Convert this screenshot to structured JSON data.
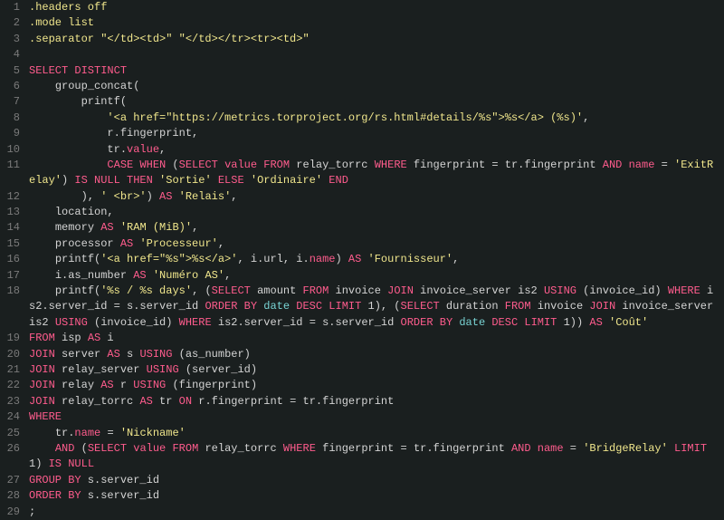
{
  "lines": [
    {
      "n": "1",
      "frags": [
        {
          "c": "str",
          "t": ".headers off"
        }
      ]
    },
    {
      "n": "2",
      "frags": [
        {
          "c": "str",
          "t": ".mode list"
        }
      ]
    },
    {
      "n": "3",
      "frags": [
        {
          "c": "str",
          "t": ".separator \"</td><td>\" \"</td></tr><tr><td>\""
        }
      ]
    },
    {
      "n": "4",
      "frags": []
    },
    {
      "n": "5",
      "frags": [
        {
          "c": "kw",
          "t": "SELECT DISTINCT"
        }
      ]
    },
    {
      "n": "6",
      "frags": [
        {
          "c": "ident",
          "t": "    group_concat("
        }
      ]
    },
    {
      "n": "7",
      "frags": [
        {
          "c": "ident",
          "t": "        printf("
        }
      ]
    },
    {
      "n": "8",
      "frags": [
        {
          "c": "ident",
          "t": "            "
        },
        {
          "c": "str",
          "t": "'<a href=\"https://metrics.torproject.org/rs.html#details/%s\">%s</a> (%s)'"
        },
        {
          "c": "ident",
          "t": ","
        }
      ]
    },
    {
      "n": "9",
      "frags": [
        {
          "c": "ident",
          "t": "            r.fingerprint,"
        }
      ]
    },
    {
      "n": "10",
      "frags": [
        {
          "c": "ident",
          "t": "            tr."
        },
        {
          "c": "kw",
          "t": "value"
        },
        {
          "c": "ident",
          "t": ","
        }
      ]
    },
    {
      "n": "11",
      "frags": [
        {
          "c": "ident",
          "t": "            "
        },
        {
          "c": "kw",
          "t": "CASE WHEN"
        },
        {
          "c": "ident",
          "t": " ("
        },
        {
          "c": "kw",
          "t": "SELECT"
        },
        {
          "c": "ident",
          "t": " "
        },
        {
          "c": "kw",
          "t": "value"
        },
        {
          "c": "ident",
          "t": " "
        },
        {
          "c": "kw",
          "t": "FROM"
        },
        {
          "c": "ident",
          "t": " relay_torrc "
        },
        {
          "c": "kw",
          "t": "WHERE"
        },
        {
          "c": "ident",
          "t": " fingerprint "
        },
        {
          "c": "op",
          "t": "="
        },
        {
          "c": "ident",
          "t": " tr.fingerprint "
        },
        {
          "c": "kw",
          "t": "AND"
        },
        {
          "c": "ident",
          "t": " "
        },
        {
          "c": "kw",
          "t": "name"
        },
        {
          "c": "ident",
          "t": " "
        },
        {
          "c": "op",
          "t": "="
        },
        {
          "c": "ident",
          "t": " "
        },
        {
          "c": "str",
          "t": "'ExitRelay'"
        },
        {
          "c": "ident",
          "t": ") "
        },
        {
          "c": "kw",
          "t": "IS NULL THEN"
        },
        {
          "c": "ident",
          "t": " "
        },
        {
          "c": "str",
          "t": "'Sortie'"
        },
        {
          "c": "ident",
          "t": " "
        },
        {
          "c": "kw",
          "t": "ELSE"
        },
        {
          "c": "ident",
          "t": " "
        },
        {
          "c": "str",
          "t": "'Ordinaire'"
        },
        {
          "c": "ident",
          "t": " "
        },
        {
          "c": "kw",
          "t": "END"
        }
      ]
    },
    {
      "n": "12",
      "frags": [
        {
          "c": "ident",
          "t": "        ), "
        },
        {
          "c": "str",
          "t": "' <br>'"
        },
        {
          "c": "ident",
          "t": ") "
        },
        {
          "c": "kw",
          "t": "AS"
        },
        {
          "c": "ident",
          "t": " "
        },
        {
          "c": "str",
          "t": "'Relais'"
        },
        {
          "c": "ident",
          "t": ","
        }
      ]
    },
    {
      "n": "13",
      "frags": [
        {
          "c": "ident",
          "t": "    location,"
        }
      ]
    },
    {
      "n": "14",
      "frags": [
        {
          "c": "ident",
          "t": "    memory "
        },
        {
          "c": "kw",
          "t": "AS"
        },
        {
          "c": "ident",
          "t": " "
        },
        {
          "c": "str",
          "t": "'RAM (MiB)'"
        },
        {
          "c": "ident",
          "t": ","
        }
      ]
    },
    {
      "n": "15",
      "frags": [
        {
          "c": "ident",
          "t": "    processor "
        },
        {
          "c": "kw",
          "t": "AS"
        },
        {
          "c": "ident",
          "t": " "
        },
        {
          "c": "str",
          "t": "'Processeur'"
        },
        {
          "c": "ident",
          "t": ","
        }
      ]
    },
    {
      "n": "16",
      "frags": [
        {
          "c": "ident",
          "t": "    printf("
        },
        {
          "c": "str",
          "t": "'<a href=\"%s\">%s</a>'"
        },
        {
          "c": "ident",
          "t": ", i.url, i."
        },
        {
          "c": "kw",
          "t": "name"
        },
        {
          "c": "ident",
          "t": ") "
        },
        {
          "c": "kw",
          "t": "AS"
        },
        {
          "c": "ident",
          "t": " "
        },
        {
          "c": "str",
          "t": "'Fournisseur'"
        },
        {
          "c": "ident",
          "t": ","
        }
      ]
    },
    {
      "n": "17",
      "frags": [
        {
          "c": "ident",
          "t": "    i.as_number "
        },
        {
          "c": "kw",
          "t": "AS"
        },
        {
          "c": "ident",
          "t": " "
        },
        {
          "c": "str",
          "t": "'Numéro AS'"
        },
        {
          "c": "ident",
          "t": ","
        }
      ]
    },
    {
      "n": "18",
      "frags": [
        {
          "c": "ident",
          "t": "    printf("
        },
        {
          "c": "str",
          "t": "'%s / %s days'"
        },
        {
          "c": "ident",
          "t": ", ("
        },
        {
          "c": "kw",
          "t": "SELECT"
        },
        {
          "c": "ident",
          "t": " amount "
        },
        {
          "c": "kw",
          "t": "FROM"
        },
        {
          "c": "ident",
          "t": " invoice "
        },
        {
          "c": "kw",
          "t": "JOIN"
        },
        {
          "c": "ident",
          "t": " invoice_server is2 "
        },
        {
          "c": "kw",
          "t": "USING"
        },
        {
          "c": "ident",
          "t": " (invoice_id) "
        },
        {
          "c": "kw",
          "t": "WHERE"
        },
        {
          "c": "ident",
          "t": " is2.server_id "
        },
        {
          "c": "op",
          "t": "="
        },
        {
          "c": "ident",
          "t": " s.server_id "
        },
        {
          "c": "kw",
          "t": "ORDER BY"
        },
        {
          "c": "ident",
          "t": " "
        },
        {
          "c": "cyan",
          "t": "date"
        },
        {
          "c": "ident",
          "t": " "
        },
        {
          "c": "kw",
          "t": "DESC LIMIT"
        },
        {
          "c": "ident",
          "t": " 1), ("
        },
        {
          "c": "kw",
          "t": "SELECT"
        },
        {
          "c": "ident",
          "t": " duration "
        },
        {
          "c": "kw",
          "t": "FROM"
        },
        {
          "c": "ident",
          "t": " invoice "
        },
        {
          "c": "kw",
          "t": "JOIN"
        },
        {
          "c": "ident",
          "t": " invoice_server is2 "
        },
        {
          "c": "kw",
          "t": "USING"
        },
        {
          "c": "ident",
          "t": " (invoice_id) "
        },
        {
          "c": "kw",
          "t": "WHERE"
        },
        {
          "c": "ident",
          "t": " is2.server_id "
        },
        {
          "c": "op",
          "t": "="
        },
        {
          "c": "ident",
          "t": " s.server_id "
        },
        {
          "c": "kw",
          "t": "ORDER BY"
        },
        {
          "c": "ident",
          "t": " "
        },
        {
          "c": "cyan",
          "t": "date"
        },
        {
          "c": "ident",
          "t": " "
        },
        {
          "c": "kw",
          "t": "DESC LIMIT"
        },
        {
          "c": "ident",
          "t": " 1)) "
        },
        {
          "c": "kw",
          "t": "AS"
        },
        {
          "c": "ident",
          "t": " "
        },
        {
          "c": "str",
          "t": "'Coût'"
        }
      ]
    },
    {
      "n": "19",
      "frags": [
        {
          "c": "kw",
          "t": "FROM"
        },
        {
          "c": "ident",
          "t": " isp "
        },
        {
          "c": "kw",
          "t": "AS"
        },
        {
          "c": "ident",
          "t": " i"
        }
      ]
    },
    {
      "n": "20",
      "frags": [
        {
          "c": "kw",
          "t": "JOIN"
        },
        {
          "c": "ident",
          "t": " server "
        },
        {
          "c": "kw",
          "t": "AS"
        },
        {
          "c": "ident",
          "t": " s "
        },
        {
          "c": "kw",
          "t": "USING"
        },
        {
          "c": "ident",
          "t": " (as_number)"
        }
      ]
    },
    {
      "n": "21",
      "frags": [
        {
          "c": "kw",
          "t": "JOIN"
        },
        {
          "c": "ident",
          "t": " relay_server "
        },
        {
          "c": "kw",
          "t": "USING"
        },
        {
          "c": "ident",
          "t": " (server_id)"
        }
      ]
    },
    {
      "n": "22",
      "frags": [
        {
          "c": "kw",
          "t": "JOIN"
        },
        {
          "c": "ident",
          "t": " relay "
        },
        {
          "c": "kw",
          "t": "AS"
        },
        {
          "c": "ident",
          "t": " r "
        },
        {
          "c": "kw",
          "t": "USING"
        },
        {
          "c": "ident",
          "t": " (fingerprint)"
        }
      ]
    },
    {
      "n": "23",
      "frags": [
        {
          "c": "kw",
          "t": "JOIN"
        },
        {
          "c": "ident",
          "t": " relay_torrc "
        },
        {
          "c": "kw",
          "t": "AS"
        },
        {
          "c": "ident",
          "t": " tr "
        },
        {
          "c": "kw",
          "t": "ON"
        },
        {
          "c": "ident",
          "t": " r.fingerprint "
        },
        {
          "c": "op",
          "t": "="
        },
        {
          "c": "ident",
          "t": " tr.fingerprint"
        }
      ]
    },
    {
      "n": "24",
      "frags": [
        {
          "c": "kw",
          "t": "WHERE"
        }
      ]
    },
    {
      "n": "25",
      "frags": [
        {
          "c": "ident",
          "t": "    tr."
        },
        {
          "c": "kw",
          "t": "name"
        },
        {
          "c": "ident",
          "t": " "
        },
        {
          "c": "op",
          "t": "="
        },
        {
          "c": "ident",
          "t": " "
        },
        {
          "c": "str",
          "t": "'Nickname'"
        }
      ]
    },
    {
      "n": "26",
      "frags": [
        {
          "c": "ident",
          "t": "    "
        },
        {
          "c": "kw",
          "t": "AND"
        },
        {
          "c": "ident",
          "t": " ("
        },
        {
          "c": "kw",
          "t": "SELECT"
        },
        {
          "c": "ident",
          "t": " "
        },
        {
          "c": "kw",
          "t": "value"
        },
        {
          "c": "ident",
          "t": " "
        },
        {
          "c": "kw",
          "t": "FROM"
        },
        {
          "c": "ident",
          "t": " relay_torrc "
        },
        {
          "c": "kw",
          "t": "WHERE"
        },
        {
          "c": "ident",
          "t": " fingerprint "
        },
        {
          "c": "op",
          "t": "="
        },
        {
          "c": "ident",
          "t": " tr.fingerprint "
        },
        {
          "c": "kw",
          "t": "AND"
        },
        {
          "c": "ident",
          "t": " "
        },
        {
          "c": "kw",
          "t": "name"
        },
        {
          "c": "ident",
          "t": " "
        },
        {
          "c": "op",
          "t": "="
        },
        {
          "c": "ident",
          "t": " "
        },
        {
          "c": "str",
          "t": "'BridgeRelay'"
        },
        {
          "c": "ident",
          "t": " "
        },
        {
          "c": "kw",
          "t": "LIMIT"
        },
        {
          "c": "ident",
          "t": " 1) "
        },
        {
          "c": "kw",
          "t": "IS NULL"
        }
      ]
    },
    {
      "n": "27",
      "frags": [
        {
          "c": "kw",
          "t": "GROUP BY"
        },
        {
          "c": "ident",
          "t": " s.server_id"
        }
      ]
    },
    {
      "n": "28",
      "frags": [
        {
          "c": "kw",
          "t": "ORDER BY"
        },
        {
          "c": "ident",
          "t": " s.server_id"
        }
      ]
    },
    {
      "n": "29",
      "frags": [
        {
          "c": "ident",
          "t": ";"
        }
      ]
    }
  ]
}
